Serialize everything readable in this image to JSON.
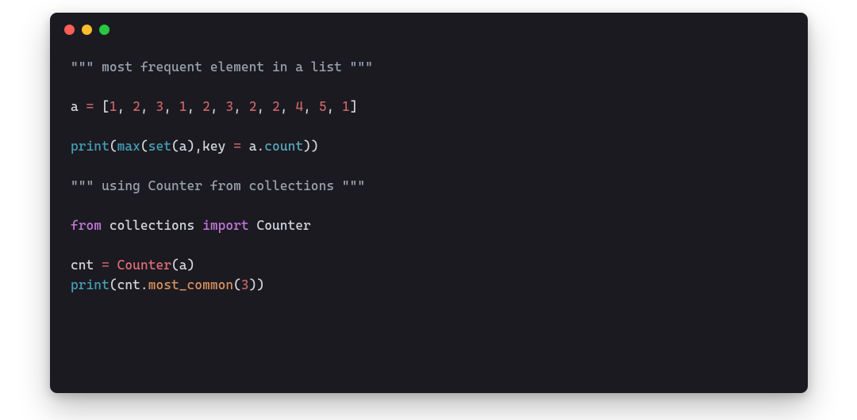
{
  "window": {
    "dots": [
      "red",
      "yellow",
      "green"
    ]
  },
  "code": {
    "lines": [
      [
        {
          "t": "\"\"\" most frequent element in a list \"\"\"",
          "c": "t-str"
        }
      ],
      [],
      [
        {
          "t": "a ",
          "c": "t-ident"
        },
        {
          "t": "=",
          "c": "t-op"
        },
        {
          "t": " [",
          "c": "t-punc"
        },
        {
          "t": "1",
          "c": "t-num"
        },
        {
          "t": ", ",
          "c": "t-punc"
        },
        {
          "t": "2",
          "c": "t-num"
        },
        {
          "t": ", ",
          "c": "t-punc"
        },
        {
          "t": "3",
          "c": "t-num"
        },
        {
          "t": ", ",
          "c": "t-punc"
        },
        {
          "t": "1",
          "c": "t-num"
        },
        {
          "t": ", ",
          "c": "t-punc"
        },
        {
          "t": "2",
          "c": "t-num"
        },
        {
          "t": ", ",
          "c": "t-punc"
        },
        {
          "t": "3",
          "c": "t-num"
        },
        {
          "t": ", ",
          "c": "t-punc"
        },
        {
          "t": "2",
          "c": "t-num"
        },
        {
          "t": ", ",
          "c": "t-punc"
        },
        {
          "t": "2",
          "c": "t-num"
        },
        {
          "t": ", ",
          "c": "t-punc"
        },
        {
          "t": "4",
          "c": "t-num"
        },
        {
          "t": ", ",
          "c": "t-punc"
        },
        {
          "t": "5",
          "c": "t-num"
        },
        {
          "t": ", ",
          "c": "t-punc"
        },
        {
          "t": "1",
          "c": "t-num"
        },
        {
          "t": "]",
          "c": "t-punc"
        }
      ],
      [],
      [
        {
          "t": "print",
          "c": "t-func"
        },
        {
          "t": "(",
          "c": "t-punc"
        },
        {
          "t": "max",
          "c": "t-func"
        },
        {
          "t": "(",
          "c": "t-punc"
        },
        {
          "t": "set",
          "c": "t-func"
        },
        {
          "t": "(a),key ",
          "c": "t-punc"
        },
        {
          "t": "=",
          "c": "t-op"
        },
        {
          "t": " a.",
          "c": "t-punc"
        },
        {
          "t": "count",
          "c": "t-attr"
        },
        {
          "t": "))",
          "c": "t-punc"
        }
      ],
      [],
      [
        {
          "t": "\"\"\" using Counter from collections \"\"\"",
          "c": "t-str"
        }
      ],
      [],
      [
        {
          "t": "from",
          "c": "t-key"
        },
        {
          "t": " collections ",
          "c": "t-ident"
        },
        {
          "t": "import",
          "c": "t-key"
        },
        {
          "t": " Counter",
          "c": "t-ident"
        }
      ],
      [],
      [
        {
          "t": "cnt ",
          "c": "t-ident"
        },
        {
          "t": "=",
          "c": "t-op"
        },
        {
          "t": " ",
          "c": "t-punc"
        },
        {
          "t": "Counter",
          "c": "t-name2"
        },
        {
          "t": "(a)",
          "c": "t-punc"
        }
      ],
      [
        {
          "t": "print",
          "c": "t-func"
        },
        {
          "t": "(cnt.",
          "c": "t-punc"
        },
        {
          "t": "most_common",
          "c": "t-prop"
        },
        {
          "t": "(",
          "c": "t-punc"
        },
        {
          "t": "3",
          "c": "t-num"
        },
        {
          "t": "))",
          "c": "t-punc"
        }
      ]
    ]
  }
}
